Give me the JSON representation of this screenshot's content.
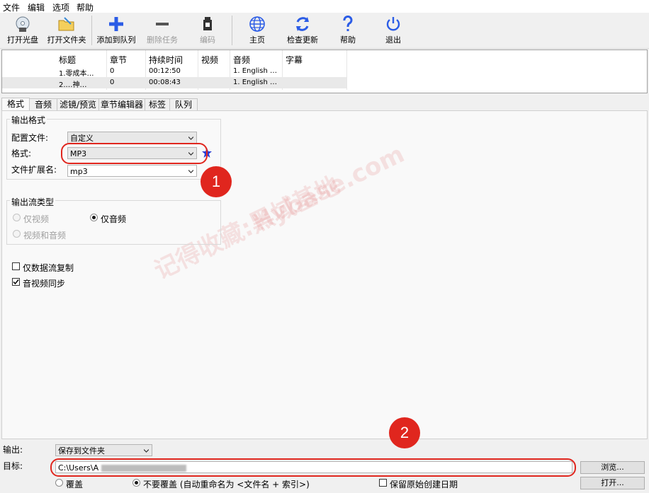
{
  "menu": [
    "文件",
    "编辑",
    "选项",
    "帮助"
  ],
  "toolbar": {
    "open_disc": "打开光盘",
    "open_folder": "打开文件夹",
    "add_queue": "添加到队列",
    "delete_task": "删除任务",
    "encode": "编码",
    "home": "主页",
    "check_update": "检查更新",
    "help": "帮助",
    "exit": "退出"
  },
  "title_list": {
    "headers": [
      "标题",
      "章节",
      "持续时间",
      "视频",
      "音频",
      "字幕"
    ],
    "rows": [
      {
        "title": "1.零成本…",
        "chapter": "0",
        "duration": "00:12:50",
        "video": "",
        "audio": "1. English …",
        "subtitle": ""
      },
      {
        "title": "2.…神…",
        "chapter": "0",
        "duration": "00:08:43",
        "video": "",
        "audio": "1. English …",
        "subtitle": ""
      }
    ]
  },
  "tabs": [
    "格式",
    "音频",
    "滤镜/预览",
    "章节编辑器",
    "标签",
    "队列"
  ],
  "output_format": {
    "group_title": "输出格式",
    "profile_label": "配置文件:",
    "profile_value": "自定义",
    "format_label": "格式:",
    "format_value": "MP3",
    "ext_label": "文件扩展名:",
    "ext_value": "mp3"
  },
  "stream_type": {
    "group_title": "输出流类型",
    "video_only": "仅视频",
    "audio_only": "仅音频",
    "video_audio": "视频和音频",
    "selected": "仅音频"
  },
  "options": {
    "stream_copy": "仅数据流复制",
    "stream_copy_checked": false,
    "av_sync": "音视频同步",
    "av_sync_checked": true
  },
  "output": {
    "output_label": "输出:",
    "output_value": "保存到文件夹",
    "target_label": "目标:",
    "target_value": "C:\\Users\\A",
    "browse": "浏览...",
    "open": "打开...",
    "overwrite": "覆盖",
    "no_overwrite": "不要覆盖 (自动重命名为 <文件名 + 索引>)",
    "overwrite_selected": "不要覆盖",
    "keep_date": "保留原始创建日期",
    "keep_date_checked": false
  },
  "annotations": {
    "badge1": "1",
    "badge2": "2",
    "accent_color": "#e0261e"
  },
  "watermark": {
    "line1": "记得收藏:黑域基地",
    "line2": "Hybase.com"
  }
}
